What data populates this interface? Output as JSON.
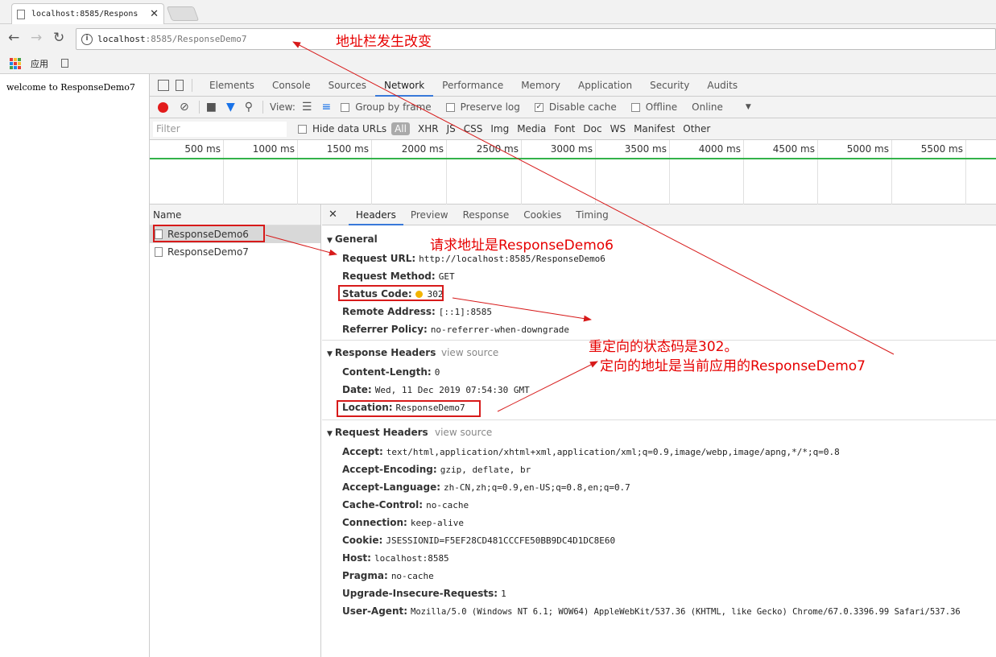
{
  "browser": {
    "tab_title": "localhost:8585/Respons",
    "url_host": "localhost",
    "url_path": ":8585/ResponseDemo7",
    "bookmark_apps": "应用"
  },
  "page": {
    "welcome_text": "welcome to ResponseDemo7"
  },
  "devtools": {
    "tabs": [
      "Elements",
      "Console",
      "Sources",
      "Network",
      "Performance",
      "Memory",
      "Application",
      "Security",
      "Audits"
    ],
    "toolbar": {
      "view_label": "View:",
      "group_by_frame": "Group by frame",
      "preserve_log": "Preserve log",
      "disable_cache": "Disable cache",
      "offline": "Offline",
      "online": "Online"
    },
    "filter": {
      "placeholder": "Filter",
      "hide_data_urls": "Hide data URLs",
      "all": "All",
      "types": [
        "XHR",
        "JS",
        "CSS",
        "Img",
        "Media",
        "Font",
        "Doc",
        "WS",
        "Manifest",
        "Other"
      ]
    },
    "timeline_ticks": [
      "500 ms",
      "1000 ms",
      "1500 ms",
      "2000 ms",
      "2500 ms",
      "3000 ms",
      "3500 ms",
      "4000 ms",
      "4500 ms",
      "5000 ms",
      "5500 ms"
    ],
    "name_header": "Name",
    "requests": [
      "ResponseDemo6",
      "ResponseDemo7"
    ],
    "detail_tabs": [
      "Headers",
      "Preview",
      "Response",
      "Cookies",
      "Timing"
    ],
    "general": {
      "title": "General",
      "rows": [
        {
          "k": "Request URL:",
          "v": "http://localhost:8585/ResponseDemo6"
        },
        {
          "k": "Request Method:",
          "v": "GET"
        },
        {
          "k": "Status Code:",
          "v": "302"
        },
        {
          "k": "Remote Address:",
          "v": "[::1]:8585"
        },
        {
          "k": "Referrer Policy:",
          "v": "no-referrer-when-downgrade"
        }
      ]
    },
    "response_headers": {
      "title": "Response Headers",
      "view_source": "view source",
      "rows": [
        {
          "k": "Content-Length:",
          "v": "0"
        },
        {
          "k": "Date:",
          "v": "Wed, 11 Dec 2019 07:54:30 GMT"
        },
        {
          "k": "Location:",
          "v": "ResponseDemo7"
        }
      ]
    },
    "request_headers": {
      "title": "Request Headers",
      "view_source": "view source",
      "rows": [
        {
          "k": "Accept:",
          "v": "text/html,application/xhtml+xml,application/xml;q=0.9,image/webp,image/apng,*/*;q=0.8"
        },
        {
          "k": "Accept-Encoding:",
          "v": "gzip, deflate, br"
        },
        {
          "k": "Accept-Language:",
          "v": "zh-CN,zh;q=0.9,en-US;q=0.8,en;q=0.7"
        },
        {
          "k": "Cache-Control:",
          "v": "no-cache"
        },
        {
          "k": "Connection:",
          "v": "keep-alive"
        },
        {
          "k": "Cookie:",
          "v": "JSESSIONID=F5EF28CD481CCCFE50BB9DC4D1DC8E60"
        },
        {
          "k": "Host:",
          "v": "localhost:8585"
        },
        {
          "k": "Pragma:",
          "v": "no-cache"
        },
        {
          "k": "Upgrade-Insecure-Requests:",
          "v": "1"
        },
        {
          "k": "User-Agent:",
          "v": "Mozilla/5.0 (Windows NT 6.1; WOW64) AppleWebKit/537.36 (KHTML, like Gecko) Chrome/67.0.3396.99 Safari/537.36"
        }
      ]
    }
  },
  "annotations": {
    "address_changed": "地址栏发生改变",
    "request_address": "请求地址是ResponseDemo6",
    "redirect_status": "重定向的状态码是302。",
    "redirect_location": "定向的地址是当前应用的ResponseDemo7"
  },
  "colors": {
    "annotation_red": "#e60000",
    "record_red": "#e21b1b",
    "active_tab_blue": "#3879d9",
    "timeline_green": "#33b24a",
    "status_orange": "#f2b300"
  }
}
